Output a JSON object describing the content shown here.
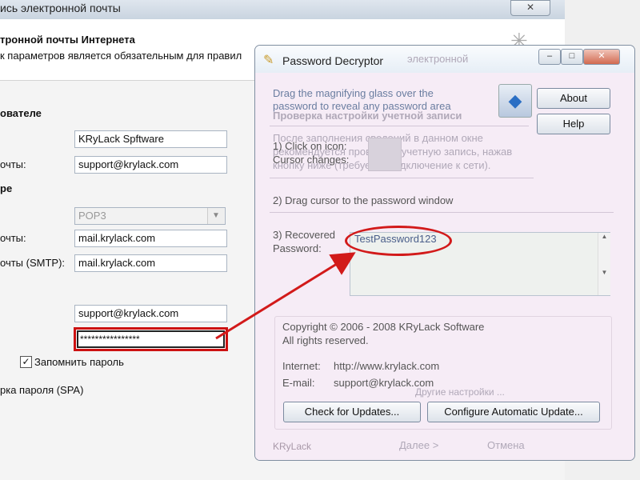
{
  "bg_window": {
    "title": "ись электронной почты",
    "close": "✕",
    "header_title": "тронной почты Интернета",
    "header_sub": "к параметров является обязательным для правил",
    "section_user": "ователе",
    "name_value": "KRyLack Spftware",
    "email_label": "очты:",
    "email_value": "support@krylack.com",
    "section_server": "ре",
    "server_type": "POP3",
    "incoming_label": "очты:",
    "incoming_value": "mail.krylack.com",
    "outgoing_label": "очты (SMTP):",
    "outgoing_value": "mail.krylack.com",
    "user_value": "support@krylack.com",
    "password_value": "****************",
    "remember_label": "Запомнить пароль",
    "spa_label": "рка пароля (SPA)",
    "ghost1": "электронной",
    "ghost2": "Проверка настройки учетной записи",
    "ghost3": "После заполнения сведений в данном окне",
    "ghost4": "рекомендуется проверить учетную запись, нажав",
    "ghost5": "кнопку ниже (требуется подключение к сети).",
    "ghost6": "Другие настройки ...",
    "ghost_next": "Далее >",
    "ghost_cancel": "Отмена"
  },
  "pd": {
    "title": "Password Decryptor",
    "instruction": "Drag the magnifying glass over the password to reveal any password area",
    "about": "About",
    "help": "Help",
    "step1": "1) Click on icon:",
    "step1b": "Cursor changes:",
    "step2": "2) Drag cursor to the password window",
    "step3a": "3) Recovered",
    "step3b": "Password:",
    "recovered": "TestPassword123",
    "copyright": "Copyright © 2006 - 2008 KRyLack Software",
    "rights": "All rights reserved.",
    "internet_label": "Internet:",
    "internet_value": "http://www.krylack.com",
    "email_label": "E-mail:",
    "email_value": "support@krylack.com",
    "check_updates": "Check for Updates...",
    "configure_update": "Configure Automatic Update...",
    "footer": "KRyLack"
  },
  "colors": {
    "annotation_red": "#cc1111",
    "link_text": "#6a7da0"
  },
  "icons": [
    "close-icon",
    "key-icon",
    "minimize-icon",
    "maximize-icon",
    "magnifier-icon",
    "checkbox-checked-icon",
    "dropdown-arrow-icon",
    "red-arrow-annotation"
  ]
}
